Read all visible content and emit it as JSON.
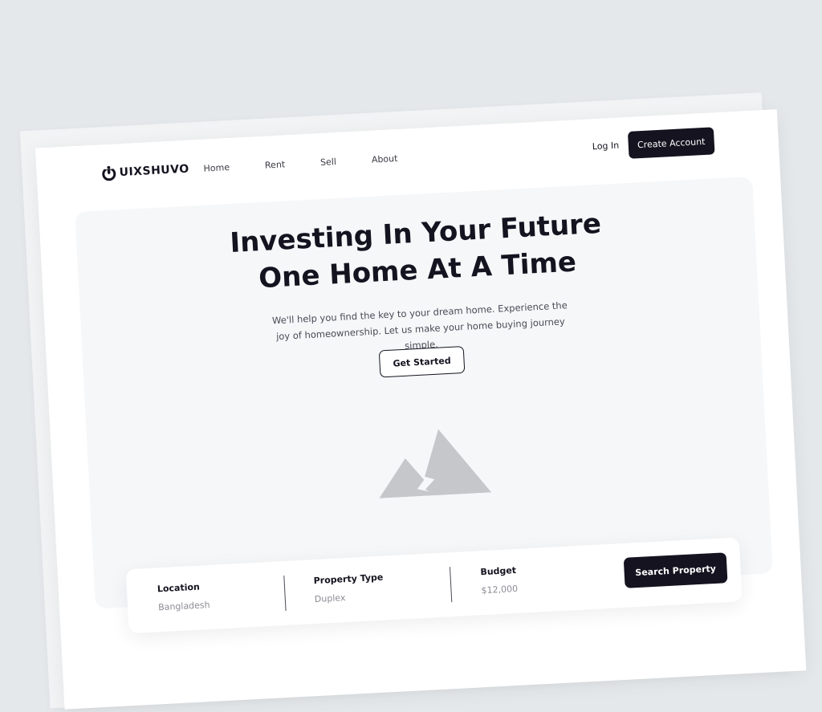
{
  "nav": {
    "brand": "UIXSHUVO",
    "links": [
      "Home",
      "Rent",
      "Sell",
      "About"
    ],
    "login_label": "Log In",
    "create_account_label": "Create Account"
  },
  "hero": {
    "title_line1": "Investing In Your Future",
    "title_line2": "One Home At A Time",
    "subtitle": "We'll help you find the key to your dream home. Experience the joy of homeownership. Let us make your home buying journey simple.",
    "cta_label": "Get Started",
    "image_icon": "image-placeholder-icon"
  },
  "search": {
    "location_label": "Location",
    "location_value": "Bangladesh",
    "property_type_label": "Property Type",
    "property_type_value": "Duplex",
    "budget_label": "Budget",
    "budget_value": "$12,000",
    "button_label": "Search Property"
  },
  "colors": {
    "background": "#e4e8eb",
    "accent_dark": "#14131f",
    "hero_bg": "#f5f7f9",
    "placeholder_gray": "#c6c7ca"
  }
}
